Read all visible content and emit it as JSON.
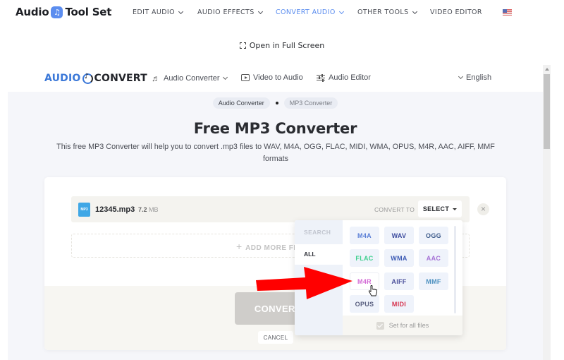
{
  "site": {
    "logo_left": "Audio",
    "logo_right": "Tool Set",
    "logo_icon": "music-note-icon",
    "nav": [
      {
        "label": "EDIT AUDIO",
        "has_dropdown": true,
        "active": false
      },
      {
        "label": "AUDIO EFFECTS",
        "has_dropdown": true,
        "active": false
      },
      {
        "label": "CONVERT AUDIO",
        "has_dropdown": true,
        "active": true
      },
      {
        "label": "OTHER TOOLS",
        "has_dropdown": true,
        "active": false
      },
      {
        "label": "VIDEO EDITOR",
        "has_dropdown": false,
        "active": false
      }
    ],
    "language_flag": "us-flag-icon",
    "fullscreen_label": "Open in Full Screen",
    "accent_color": "#5b8def"
  },
  "app": {
    "logo_left": "AUDIO",
    "logo_right": "CONVERT",
    "nav": [
      {
        "label": "Audio Converter",
        "icon": "music-notes-icon",
        "has_dropdown": true
      },
      {
        "label": "Video to Audio",
        "icon": "play-icon",
        "has_dropdown": false
      },
      {
        "label": "Audio Editor",
        "icon": "sliders-icon",
        "has_dropdown": false
      }
    ],
    "language": "English",
    "breadcrumb": [
      "Audio Converter",
      "MP3 Converter"
    ],
    "title": "Free MP3 Converter",
    "description": "This free MP3 Converter will help you to convert .mp3 files to WAV, M4A, OGG, FLAC, MIDI, WMA, OPUS, M4R, AAC, AIFF, MMF formats"
  },
  "converter": {
    "file": {
      "name": "12345.mp3",
      "size_value": "7.2",
      "size_unit": "MB",
      "icon_label": "MP3"
    },
    "convert_to_label": "CONVERT TO",
    "select_label": "SELECT",
    "remove_icon": "×",
    "add_more_label": "ADD MORE FILES",
    "convert_label": "CONVERT",
    "cancel_label": "CANCEL"
  },
  "dropdown": {
    "search_placeholder": "SEARCH",
    "categories": [
      "ALL"
    ],
    "formats": [
      {
        "label": "M4A",
        "color": "#5b7fd6"
      },
      {
        "label": "WAV",
        "color": "#3b4a9e"
      },
      {
        "label": "OGG",
        "color": "#3c5a8a"
      },
      {
        "label": "FLAC",
        "color": "#3ecf8e"
      },
      {
        "label": "WMA",
        "color": "#3d5bb5"
      },
      {
        "label": "AAC",
        "color": "#a673d6"
      },
      {
        "label": "M4R",
        "color": "#d36ad6"
      },
      {
        "label": "AIFF",
        "color": "#4a4f9a"
      },
      {
        "label": "MMF",
        "color": "#4a8fbf"
      },
      {
        "label": "OPUS",
        "color": "#5a6080"
      },
      {
        "label": "MIDI",
        "color": "#d6344f"
      }
    ],
    "hovered_format": "M4R",
    "set_for_all_label": "Set for all files",
    "set_for_all_checked": true
  },
  "annotation": {
    "arrow_color": "#ff0000",
    "points_to": "M4R"
  }
}
